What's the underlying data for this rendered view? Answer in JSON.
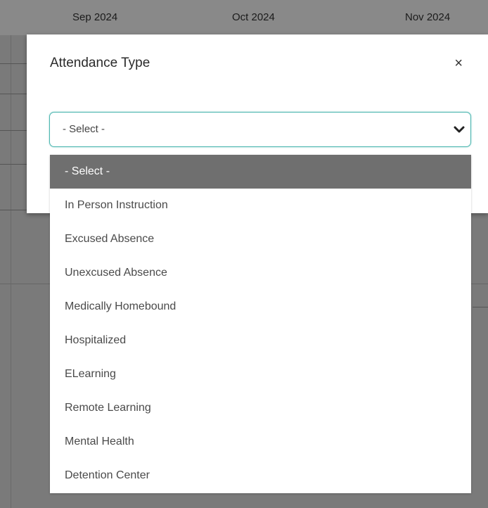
{
  "calendar": {
    "months": [
      "Sep 2024",
      "Oct 2024",
      "Nov 2024"
    ]
  },
  "modal": {
    "title": "Attendance Type",
    "close_label": "×"
  },
  "select": {
    "value": "- Select -",
    "options": [
      "- Select -",
      "In Person Instruction",
      "Excused Absence",
      "Unexcused Absence",
      "Medically Homebound",
      "Hospitalized",
      "ELearning",
      "Remote Learning",
      "Mental Health",
      "Detention Center"
    ],
    "selected_index": 0
  },
  "colors": {
    "select_border": "#4cb6b0",
    "selected_option_bg": "#6f6f6f",
    "overlay": "#6c6c6c"
  },
  "icons": {
    "close": "close-icon",
    "dropdown": "chevron-down-icon"
  }
}
